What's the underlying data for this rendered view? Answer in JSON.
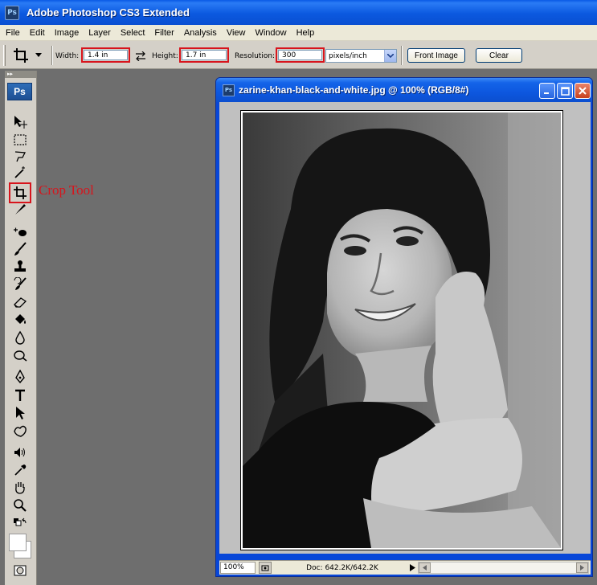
{
  "app": {
    "title": "Adobe Photoshop CS3 Extended",
    "icon_text": "Ps"
  },
  "menu": [
    "File",
    "Edit",
    "Image",
    "Layer",
    "Select",
    "Filter",
    "Analysis",
    "View",
    "Window",
    "Help"
  ],
  "options": {
    "width_label": "Width:",
    "width_value": "1.4 in",
    "height_label": "Height:",
    "height_value": "1.7 in",
    "resolution_label": "Resolution:",
    "resolution_value": "300",
    "units_value": "pixels/inch",
    "front_image_label": "Front Image",
    "clear_label": "Clear"
  },
  "toolbox": {
    "header_glyph": "▸▸",
    "logo": "Ps",
    "tools": [
      "move-tool",
      "marquee-tool",
      "lasso-tool",
      "magic-wand-tool",
      "crop-tool",
      "slice-tool",
      "healing-brush-tool",
      "brush-tool",
      "clone-stamp-tool",
      "history-brush-tool",
      "eraser-tool",
      "paint-bucket-tool",
      "blur-tool",
      "dodge-tool",
      "pen-tool",
      "type-tool",
      "path-selection-tool",
      "custom-shape-tool",
      "notes-tool",
      "eyedropper-tool",
      "hand-tool",
      "zoom-tool"
    ],
    "highlighted_tool": "crop-tool"
  },
  "annotation": {
    "crop_tool_label": "Crop Tool",
    "color": "#d8141c"
  },
  "document": {
    "title": "zarine-khan-black-and-white.jpg @ 100% (RGB/8#)",
    "icon_text": "Ps",
    "zoom": "100%",
    "doc_size": "Doc: 642.2K/642.2K"
  },
  "colors": {
    "titlebar_blue": "#0b59e0",
    "highlight_red": "#d8141c",
    "workspace_gray": "#6e6e6e",
    "panel_gray": "#d4d0c8"
  }
}
